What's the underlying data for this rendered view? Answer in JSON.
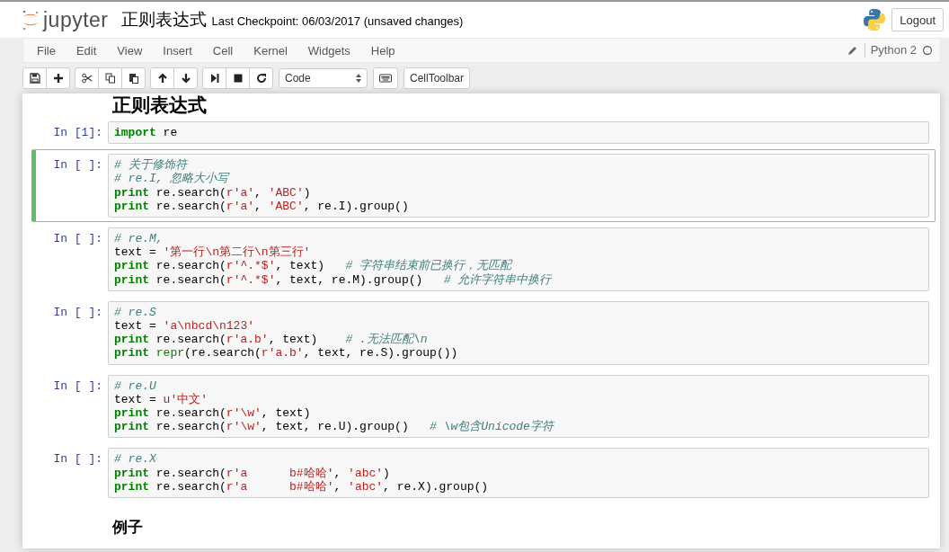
{
  "header": {
    "logo_text": "jupyter",
    "notebook_name": "正则表达式",
    "checkpoint": "Last Checkpoint: 06/03/2017 (unsaved changes)",
    "logout": "Logout"
  },
  "menubar": {
    "items": [
      "File",
      "Edit",
      "View",
      "Insert",
      "Cell",
      "Kernel",
      "Widgets",
      "Help"
    ],
    "edit_mode": true,
    "kernel_name": "Python 2",
    "kernel_busy": false
  },
  "toolbar": {
    "groups": [
      [
        {
          "kind": "save"
        },
        {
          "kind": "insert"
        }
      ],
      [
        {
          "kind": "cut"
        },
        {
          "kind": "copy"
        },
        {
          "kind": "paste"
        }
      ],
      [
        {
          "kind": "up"
        },
        {
          "kind": "down"
        }
      ],
      [
        {
          "kind": "run"
        },
        {
          "kind": "stop"
        },
        {
          "kind": "restart"
        }
      ]
    ],
    "cell_type": "Code",
    "cell_toolbar": "CellToolbar"
  },
  "cells": [
    {
      "kind": "heading",
      "text": "正则表达式"
    },
    {
      "kind": "code",
      "prompt": "In [1]:",
      "selected": false,
      "lines": [
        [
          {
            "kind": "kw",
            "text": "import"
          },
          {
            "kind": "plain",
            "text": " re"
          }
        ]
      ]
    },
    {
      "kind": "code",
      "prompt": "In [ ]:",
      "selected": true,
      "lines": [
        [
          {
            "kind": "comment",
            "text": "# 关于修饰符"
          }
        ],
        [
          {
            "kind": "comment",
            "text": "# re.I, 忽略大小写"
          }
        ],
        [
          {
            "kind": "kw",
            "text": "print"
          },
          {
            "kind": "plain",
            "text": " re.search("
          },
          {
            "kind": "str",
            "text": "r'a'"
          },
          {
            "kind": "plain",
            "text": ", "
          },
          {
            "kind": "str",
            "text": "'ABC'"
          },
          {
            "kind": "plain",
            "text": ")"
          }
        ],
        [
          {
            "kind": "kw",
            "text": "print"
          },
          {
            "kind": "plain",
            "text": " re.search("
          },
          {
            "kind": "str",
            "text": "r'a'"
          },
          {
            "kind": "plain",
            "text": ", "
          },
          {
            "kind": "str",
            "text": "'ABC'"
          },
          {
            "kind": "plain",
            "text": ", re.I).group()"
          }
        ]
      ]
    },
    {
      "kind": "code",
      "prompt": "In [ ]:",
      "selected": false,
      "lines": [
        [
          {
            "kind": "comment",
            "text": "# re.M,"
          }
        ],
        [
          {
            "kind": "plain",
            "text": "text = "
          },
          {
            "kind": "str",
            "text": "'第一行\\n第二行\\n第三行'"
          }
        ],
        [
          {
            "kind": "kw",
            "text": "print"
          },
          {
            "kind": "plain",
            "text": " re.search("
          },
          {
            "kind": "str",
            "text": "r'^.*$'"
          },
          {
            "kind": "plain",
            "text": ", text)   "
          },
          {
            "kind": "comment",
            "text": "# 字符串结束前已换行，无匹配"
          }
        ],
        [
          {
            "kind": "kw",
            "text": "print"
          },
          {
            "kind": "plain",
            "text": " re.search("
          },
          {
            "kind": "str",
            "text": "r'^.*$'"
          },
          {
            "kind": "plain",
            "text": ", text, re.M).group()   "
          },
          {
            "kind": "comment",
            "text": "# 允许字符串中换行"
          }
        ]
      ]
    },
    {
      "kind": "code",
      "prompt": "In [ ]:",
      "selected": false,
      "lines": [
        [
          {
            "kind": "comment",
            "text": "# re.S"
          }
        ],
        [
          {
            "kind": "plain",
            "text": "text = "
          },
          {
            "kind": "str",
            "text": "'a\\nbcd\\n123'"
          }
        ],
        [
          {
            "kind": "kw",
            "text": "print"
          },
          {
            "kind": "plain",
            "text": " re.search("
          },
          {
            "kind": "str",
            "text": "r'a.b'"
          },
          {
            "kind": "plain",
            "text": ", text)    "
          },
          {
            "kind": "comment",
            "text": "# .无法匹配\\n"
          }
        ],
        [
          {
            "kind": "kw",
            "text": "print"
          },
          {
            "kind": "builtin",
            "text": " repr"
          },
          {
            "kind": "plain",
            "text": "(re.search("
          },
          {
            "kind": "str",
            "text": "r'a.b'"
          },
          {
            "kind": "plain",
            "text": ", text, re.S).group())"
          }
        ]
      ]
    },
    {
      "kind": "code",
      "prompt": "In [ ]:",
      "selected": false,
      "lines": [
        [
          {
            "kind": "comment",
            "text": "# re.U"
          }
        ],
        [
          {
            "kind": "plain",
            "text": "text = "
          },
          {
            "kind": "str",
            "text": "u'中文'"
          }
        ],
        [
          {
            "kind": "kw",
            "text": "print"
          },
          {
            "kind": "plain",
            "text": " re.search("
          },
          {
            "kind": "str",
            "text": "r'\\w'"
          },
          {
            "kind": "plain",
            "text": ", text)"
          }
        ],
        [
          {
            "kind": "kw",
            "text": "print"
          },
          {
            "kind": "plain",
            "text": " re.search("
          },
          {
            "kind": "str",
            "text": "r'\\w'"
          },
          {
            "kind": "plain",
            "text": ", text, re.U).group()   "
          },
          {
            "kind": "comment",
            "text": "# \\w包含Unicode字符"
          }
        ]
      ]
    },
    {
      "kind": "code",
      "prompt": "In [ ]:",
      "selected": false,
      "lines": [
        [
          {
            "kind": "comment",
            "text": "# re.X"
          }
        ],
        [
          {
            "kind": "kw",
            "text": "print"
          },
          {
            "kind": "plain",
            "text": " re.search("
          },
          {
            "kind": "str",
            "text": "r'a      b#哈哈'"
          },
          {
            "kind": "plain",
            "text": ", "
          },
          {
            "kind": "str",
            "text": "'abc'"
          },
          {
            "kind": "plain",
            "text": ")"
          }
        ],
        [
          {
            "kind": "kw",
            "text": "print"
          },
          {
            "kind": "plain",
            "text": " re.search("
          },
          {
            "kind": "str",
            "text": "r'a      b#哈哈'"
          },
          {
            "kind": "plain",
            "text": ", "
          },
          {
            "kind": "str",
            "text": "'abc'"
          },
          {
            "kind": "plain",
            "text": ", re.X).group()"
          }
        ]
      ]
    },
    {
      "kind": "heading",
      "text": "例子"
    }
  ]
}
